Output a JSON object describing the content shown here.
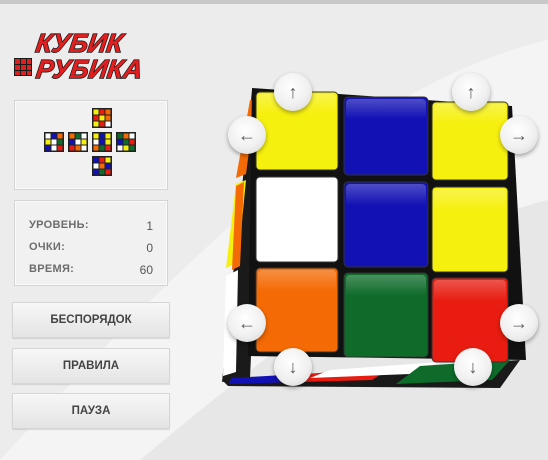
{
  "logo": {
    "line1": "КУБИК",
    "line2": "РУБИКА"
  },
  "stats": {
    "level_label": "УРОВЕНЬ:",
    "level_value": "1",
    "score_label": "ОЧКИ:",
    "score_value": "0",
    "time_label": "ВРЕМЯ:",
    "time_value": "60"
  },
  "buttons": {
    "chaos": "БЕСПОРЯДОК",
    "rules": "ПРАВИЛА",
    "pause": "ПАУЗА"
  },
  "arrows": {
    "top_left": "↑",
    "top_right": "↑",
    "left_top": "←",
    "right_top": "→",
    "left_bottom": "←",
    "right_bottom": "→",
    "bottom_left": "↓",
    "bottom_right": "↓"
  },
  "colors": {
    "yellow": "#f6f00e",
    "blue": "#1212b4",
    "white": "#ffffff",
    "orange": "#f46a04",
    "green": "#0e6b2a",
    "red": "#e81c10",
    "logo_red": "#e31e1e",
    "logo_outline": "#1a1a1a"
  },
  "cube_front": [
    [
      "yellow",
      "blue",
      "yellow"
    ],
    [
      "white",
      "blue",
      "yellow"
    ],
    [
      "orange",
      "green",
      "red"
    ]
  ],
  "cube_left_side": [
    "orange",
    "yellow",
    "white"
  ],
  "cube_bottom_side": [
    "blue",
    "red",
    "white",
    "green"
  ]
}
